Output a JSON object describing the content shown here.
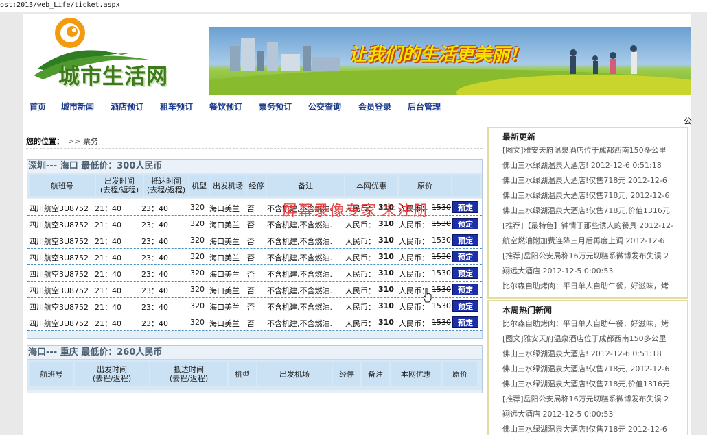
{
  "url": "ost:2013/web_Life/ticket.aspx",
  "logo_text": "城市生活网",
  "banner_slogan": "让我们的生活更美丽！",
  "nav": [
    "首页",
    "城市新闻",
    "酒店预订",
    "租车预订",
    "餐饮预订",
    "票务预订",
    "公交查询",
    "会员登录",
    "后台管理"
  ],
  "corner_glyph": "公",
  "breadcrumb": {
    "label": "您的位置：",
    "arrow": ">>",
    "current": "票务"
  },
  "watermark": "屏幕录像专家  未注册",
  "flights1": {
    "title": "深圳--- 海口  最低价：300人民币",
    "headers": [
      "航班号",
      "出发时间\n(去程/返程)",
      "抵达时间\n(去程/返程)",
      "机型",
      "出发机场",
      "经停",
      "备注",
      "本网优惠",
      "原价"
    ],
    "rows": [
      {
        "flight": "四川航空3U8752",
        "dep": "21：40",
        "arr": "23：40",
        "model": "320",
        "airport": "海口美兰",
        "stop": "否",
        "note": "不含机建,不含燃油.",
        "web_label": "人民币：",
        "web_price": "310",
        "orig_label": "人民币：",
        "orig_price": "1530",
        "book": "预定"
      },
      {
        "flight": "四川航空3U8752",
        "dep": "21：40",
        "arr": "23：40",
        "model": "320",
        "airport": "海口美兰",
        "stop": "否",
        "note": "不含机建,不含燃油.",
        "web_label": "人民币：",
        "web_price": "310",
        "orig_label": "人民币：",
        "orig_price": "1530",
        "book": "预定"
      },
      {
        "flight": "四川航空3U8752",
        "dep": "21：40",
        "arr": "23：40",
        "model": "320",
        "airport": "海口美兰",
        "stop": "否",
        "note": "不含机建,不含燃油.",
        "web_label": "人民币：",
        "web_price": "310",
        "orig_label": "人民币：",
        "orig_price": "1530",
        "book": "预定"
      },
      {
        "flight": "四川航空3U8752",
        "dep": "21：40",
        "arr": "23：40",
        "model": "320",
        "airport": "海口美兰",
        "stop": "否",
        "note": "不含机建,不含燃油.",
        "web_label": "人民币：",
        "web_price": "310",
        "orig_label": "人民币：",
        "orig_price": "1530",
        "book": "预定"
      },
      {
        "flight": "四川航空3U8752",
        "dep": "21：40",
        "arr": "23：40",
        "model": "320",
        "airport": "海口美兰",
        "stop": "否",
        "note": "不含机建,不含燃油.",
        "web_label": "人民币：",
        "web_price": "310",
        "orig_label": "人民币：",
        "orig_price": "1530",
        "book": "预定"
      },
      {
        "flight": "四川航空3U8752",
        "dep": "21：40",
        "arr": "23：40",
        "model": "320",
        "airport": "海口美兰",
        "stop": "否",
        "note": "不含机建,不含燃油.",
        "web_label": "人民币：",
        "web_price": "310",
        "orig_label": "人民币：",
        "orig_price": "1530",
        "book": "预定"
      },
      {
        "flight": "四川航空3U8752",
        "dep": "21：40",
        "arr": "23：40",
        "model": "320",
        "airport": "海口美兰",
        "stop": "否",
        "note": "不含机建,不含燃油.",
        "web_label": "人民币：",
        "web_price": "310",
        "orig_label": "人民币：",
        "orig_price": "1530",
        "book": "预定"
      },
      {
        "flight": "四川航空3U8752",
        "dep": "21：40",
        "arr": "23：40",
        "model": "320",
        "airport": "海口美兰",
        "stop": "否",
        "note": "不含机建,不含燃油.",
        "web_label": "人民币：",
        "web_price": "310",
        "orig_label": "人民币：",
        "orig_price": "1530",
        "book": "预定"
      }
    ]
  },
  "flights2": {
    "title": "海口--- 重庆  最低价：260人民币",
    "headers": [
      "航班号",
      "出发时间\n(去程/返程)",
      "抵达时间\n(去程/返程)",
      "机型",
      "出发机场",
      "经停",
      "备注",
      "本网优惠",
      "原价"
    ]
  },
  "latest": {
    "title": "最新更新",
    "items": [
      "[图文]雅安天府温泉酒店位于成都西南150多公里",
      "佛山三水绿湖温泉大酒店! 2012-12-6 0:51:18",
      "佛山三水绿湖温泉大酒店!仅售718元 2012-12-6",
      "佛山三水绿湖温泉大酒店!仅售718元, 2012-12-6",
      "佛山三水绿湖温泉大酒店!仅售718元,价值1316元",
      "[推荐]【最特色】钟情于那些诱人的餐具 2012-12-",
      "航空燃油附加费连降三月后再度上调 2012-12-6",
      "[推荐]岳阳公安局称16万元切糕系微博发布失误 2",
      "翔远大酒店 2012-12-5 0:00:53",
      "比尔森自助烤肉：平日单人自助午餐，好滋味，烤"
    ]
  },
  "hot": {
    "title": "本周热门新闻",
    "items": [
      "比尔森自助烤肉：平日单人自助午餐，好滋味，烤",
      "[图文]雅安天府温泉酒店位于成都西南150多公里",
      "佛山三水绿湖温泉大酒店! 2012-12-6 0:51:18",
      "佛山三水绿湖温泉大酒店!仅售718元, 2012-12-6",
      "佛山三水绿湖温泉大酒店!仅售718元,价值1316元",
      "[推荐]岳阳公安局称16万元切糕系微博发布失误 2",
      "翔远大酒店 2012-12-5 0:00:53",
      "佛山三水绿湖温泉大酒店!仅售718元 2012-12-6"
    ]
  },
  "colors": {
    "nav_text": "#1a3a8f",
    "book_button": "#1c2fa8",
    "watermark": "#e23232",
    "sidebar_border": "#e3dca0"
  }
}
